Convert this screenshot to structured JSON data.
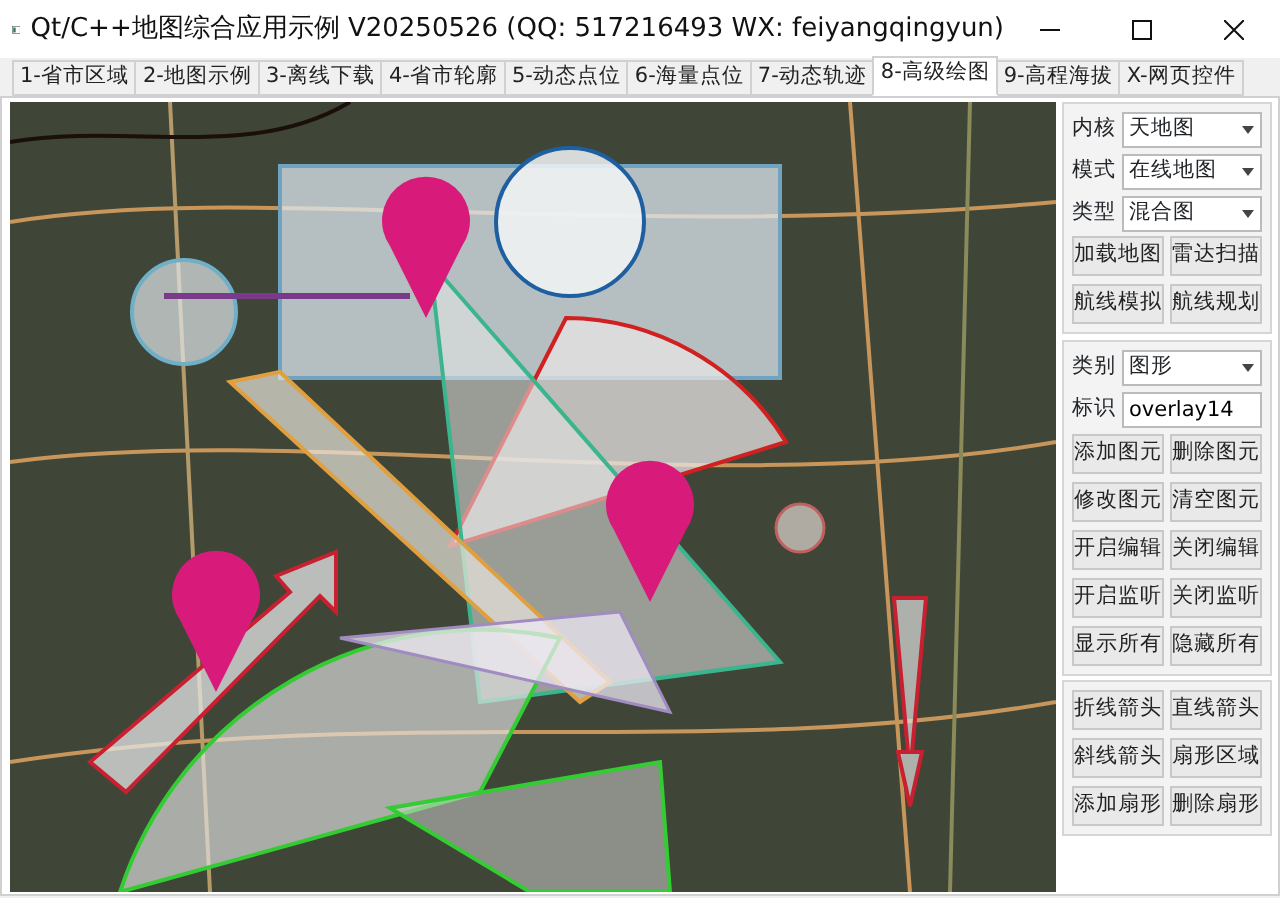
{
  "window": {
    "title": "Qt/C++地图综合应用示例 V20250526 (QQ: 517216493 WX: feiyangqingyun)"
  },
  "tabs": [
    {
      "label": "1-省市区域",
      "selected": false
    },
    {
      "label": "2-地图示例",
      "selected": false
    },
    {
      "label": "3-离线下载",
      "selected": false
    },
    {
      "label": "4-省市轮廓",
      "selected": false
    },
    {
      "label": "5-动态点位",
      "selected": false
    },
    {
      "label": "6-海量点位",
      "selected": false
    },
    {
      "label": "7-动态轨迹",
      "selected": false
    },
    {
      "label": "8-高级绘图",
      "selected": true
    },
    {
      "label": "9-高程海拔",
      "selected": false
    },
    {
      "label": "X-网页控件",
      "selected": false
    }
  ],
  "panels": [
    {
      "fields": [
        {
          "kind": "select",
          "label": "内核",
          "value": "天地图"
        },
        {
          "kind": "select",
          "label": "模式",
          "value": "在线地图"
        },
        {
          "kind": "select",
          "label": "类型",
          "value": "混合图"
        }
      ],
      "buttons": [
        "加载地图",
        "雷达扫描",
        "航线模拟",
        "航线规划"
      ]
    },
    {
      "fields": [
        {
          "kind": "select",
          "label": "类别",
          "value": "图形"
        },
        {
          "kind": "text",
          "label": "标识",
          "value": "overlay14"
        }
      ],
      "buttons": [
        "添加图元",
        "删除图元",
        "修改图元",
        "清空图元",
        "开启编辑",
        "关闭编辑",
        "开启监听",
        "关闭监听",
        "显示所有",
        "隐藏所有"
      ]
    },
    {
      "buttons": [
        "折线箭头",
        "直线箭头",
        "斜线箭头",
        "扇形区域",
        "添加扇形",
        "删除扇形"
      ]
    }
  ]
}
